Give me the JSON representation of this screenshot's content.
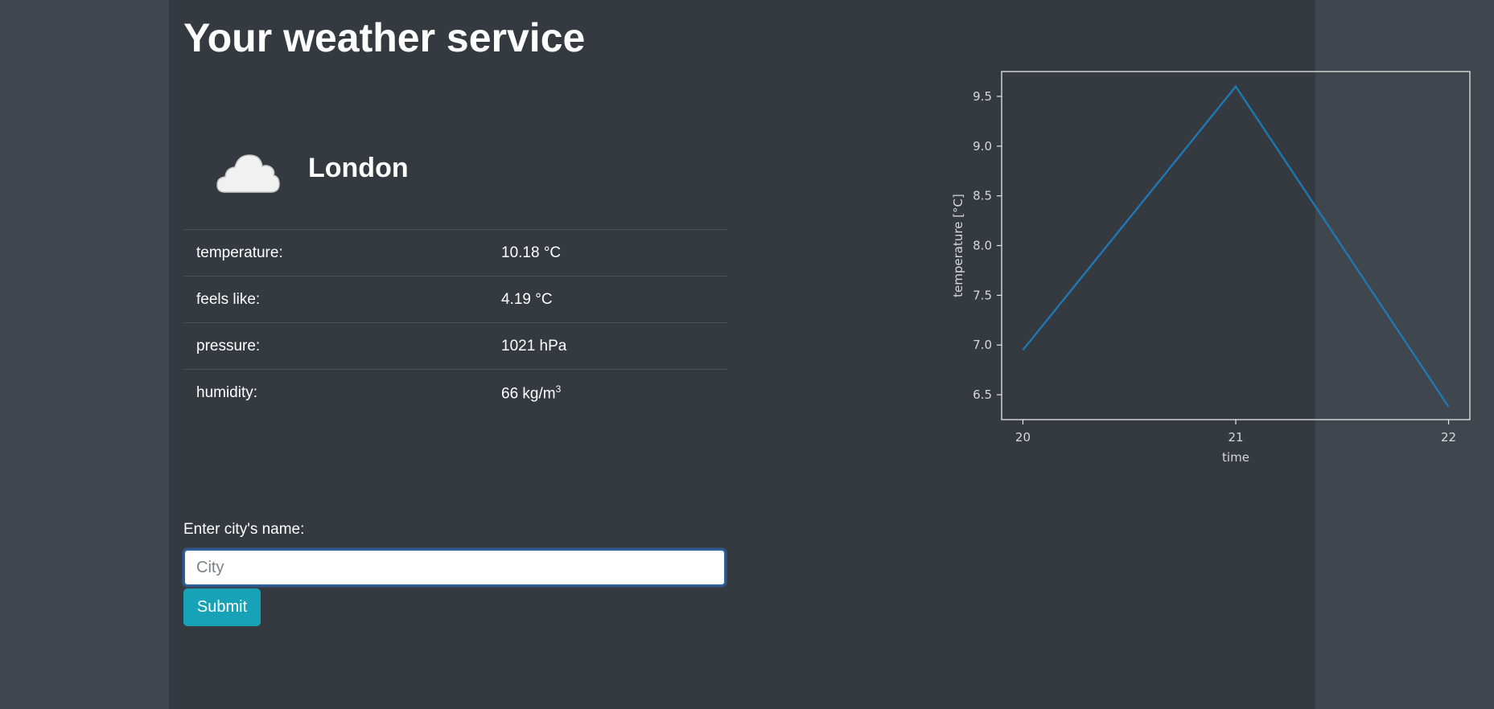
{
  "header": {
    "title": "Your weather service"
  },
  "current": {
    "icon": "cloud-icon",
    "city": "London",
    "rows": [
      {
        "label": "temperature:",
        "value": "10.18 °C"
      },
      {
        "label": "feels like:",
        "value": "4.19 °C"
      },
      {
        "label": "pressure:",
        "value": "1021 hPa"
      },
      {
        "label": "humidity:",
        "value": "66 kg/m",
        "superscript": "3"
      }
    ]
  },
  "form": {
    "label": "Enter city's name:",
    "placeholder": "City",
    "value": "",
    "submit_label": "Submit"
  },
  "colors": {
    "page_background": "#343a40",
    "outer_background": "#40464d",
    "button": "#17a2b8",
    "line": "#1f77b4"
  },
  "chart_data": {
    "type": "line",
    "x": [
      20,
      21,
      22
    ],
    "series": [
      {
        "values": [
          6.95,
          9.6,
          6.38
        ]
      }
    ],
    "xlabel": "time",
    "ylabel": "temperature [°C]",
    "xticks": [
      "20",
      "21",
      "22"
    ],
    "yticks": [
      "6.5",
      "7.0",
      "7.5",
      "8.0",
      "8.5",
      "9.0",
      "9.5"
    ],
    "xlim": [
      19.9,
      22.1
    ],
    "ylim": [
      6.25,
      9.75
    ],
    "grid": false
  }
}
